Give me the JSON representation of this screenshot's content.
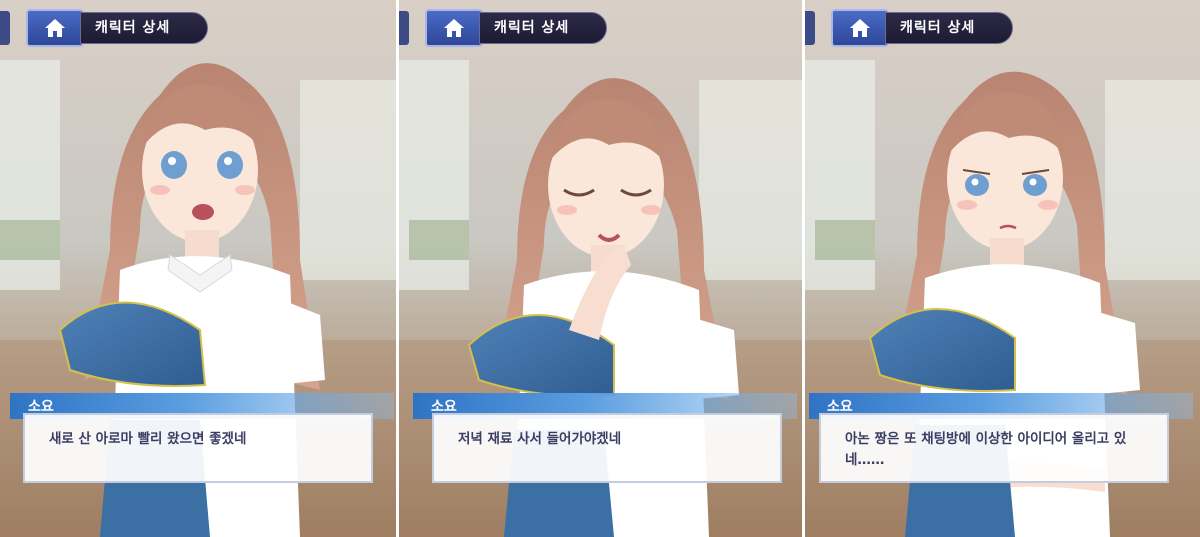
{
  "app": {
    "header_title": "캐릭터 상세",
    "home_icon": "home-icon"
  },
  "colors": {
    "header_button": "#3556aa",
    "header_title_bg": "#232040",
    "name_bar": "#2f73c4",
    "dialog_text": "#3a3e62",
    "hair": "#c4917a",
    "eyes": "#6f9ed1",
    "top_blue": "#3c6fa3"
  },
  "panels": [
    {
      "speaker": "소요",
      "line": "새로 산 아로마 빨리 왔으면 좋겠네",
      "expression": "smiling-open-mouth"
    },
    {
      "speaker": "소요",
      "line": "저녁 재료 사서 들어가야겠네",
      "expression": "eyes-closed-thinking"
    },
    {
      "speaker": "소요",
      "line": "아논 짱은 또 채팅방에 이상한 아이디어 올리고 있네……",
      "expression": "worried-arms-crossed"
    }
  ]
}
